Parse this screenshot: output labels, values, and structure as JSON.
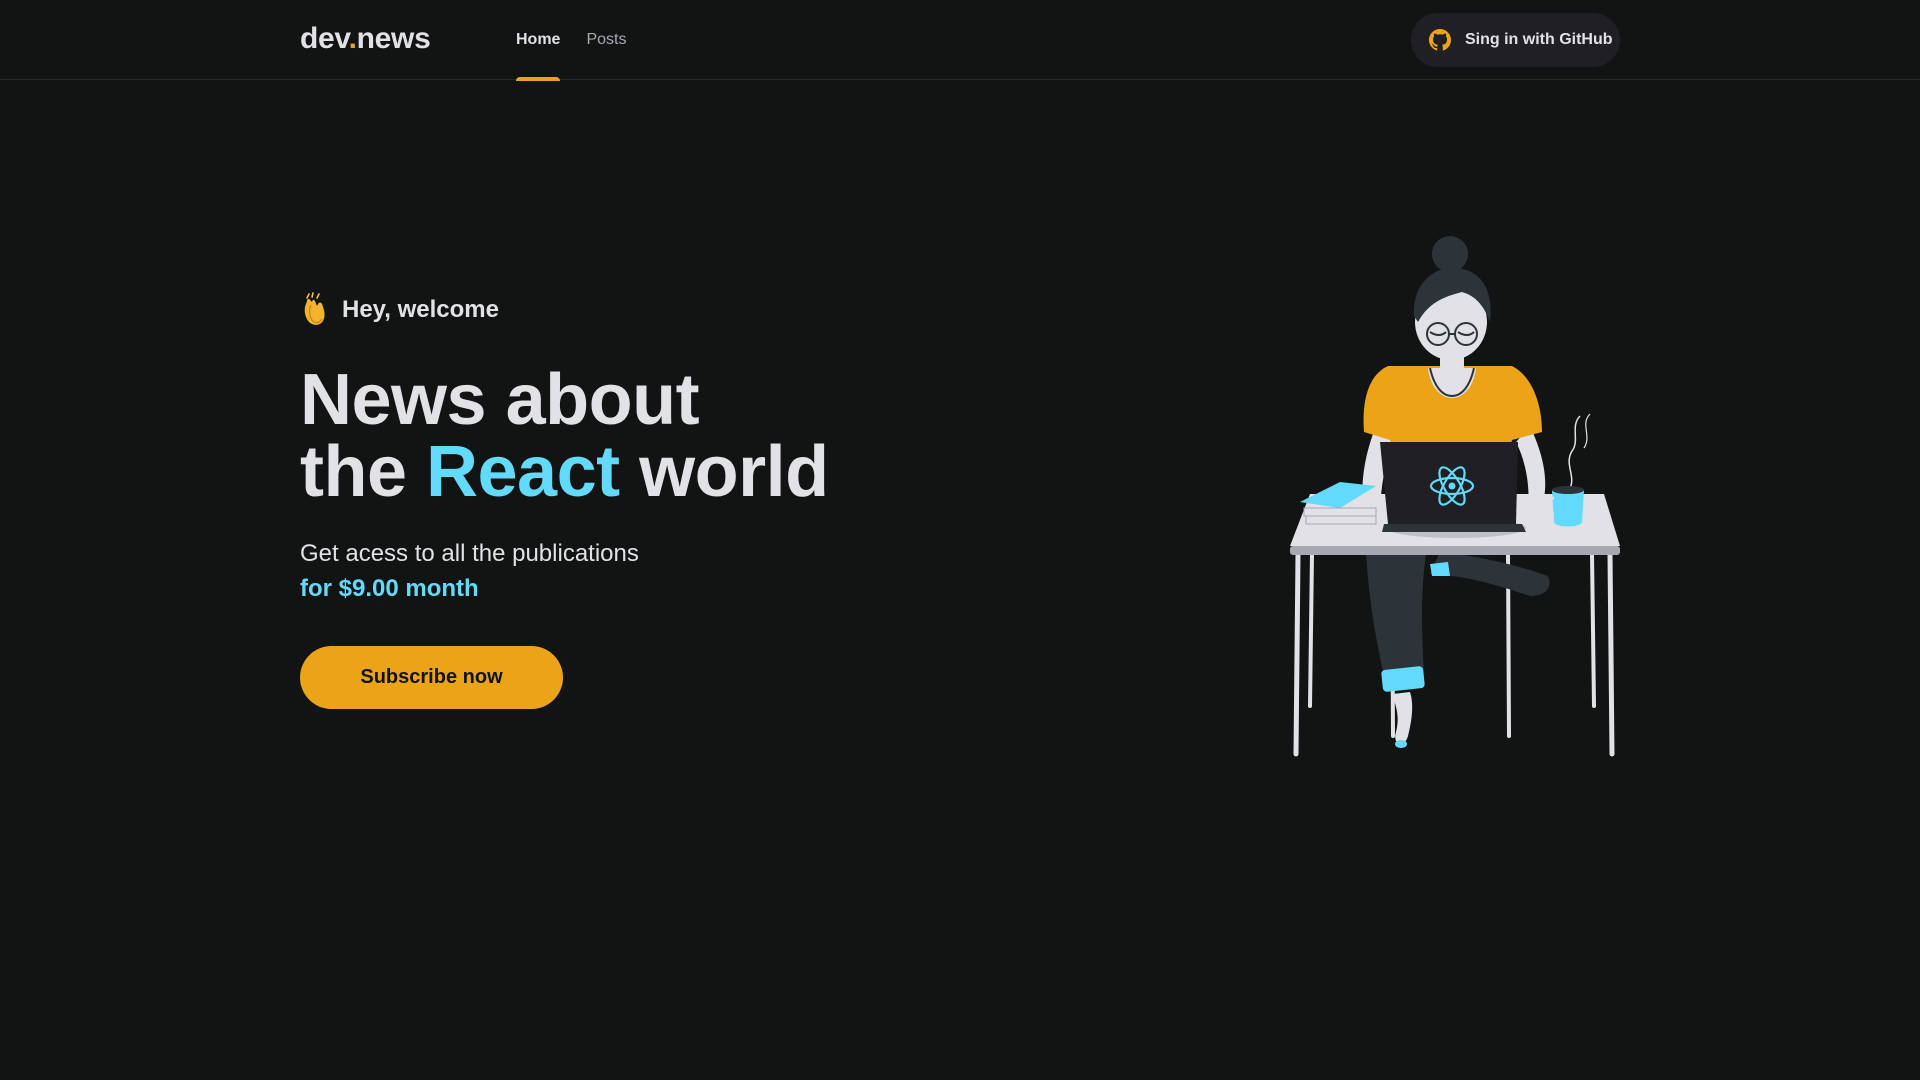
{
  "header": {
    "logo_main": "dev",
    "logo_dot": ".",
    "logo_tail": "news",
    "nav": [
      {
        "label": "Home",
        "active": true
      },
      {
        "label": "Posts",
        "active": false
      }
    ],
    "signin_label": "Sing in with GitHub",
    "signin_icon": "github-icon"
  },
  "hero": {
    "greeting_icon": "clapping-hands-icon",
    "greeting": "Hey, welcome",
    "title_line1": "News about",
    "title_line2_start": "the",
    "title_line2_accent": "React",
    "title_line2_end": "world",
    "subtitle": "Get acess to all the publications",
    "price": "for $9.00 month",
    "cta_label": "Subscribe now",
    "illustration": "woman-with-laptop-illustration"
  },
  "colors": {
    "background": "#121414",
    "accent_yellow": "#eba417",
    "accent_cyan": "#61dafb",
    "text": "#e1e1e6",
    "button_dark": "#202024"
  }
}
